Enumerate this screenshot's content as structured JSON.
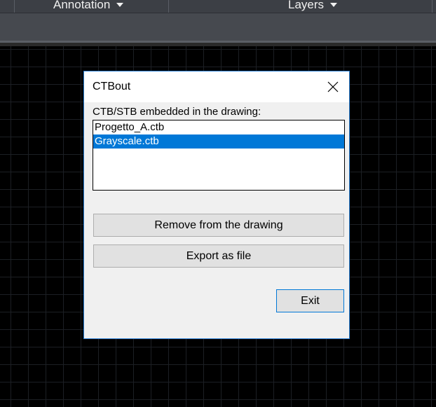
{
  "ribbon": {
    "panels": [
      {
        "label": "Annotation",
        "icon": "caret-down-icon"
      },
      {
        "label": "Layers",
        "icon": "caret-down-icon"
      }
    ]
  },
  "dialog": {
    "title": "CTBout",
    "close_icon": "close-icon",
    "list_label": "CTB/STB embedded in the drawing:",
    "items": [
      {
        "label": "Progetto_A.ctb",
        "selected": false
      },
      {
        "label": "Grayscale.ctb",
        "selected": true
      }
    ],
    "buttons": {
      "remove": "Remove from the drawing",
      "export": "Export as file",
      "exit": "Exit"
    }
  },
  "colors": {
    "selection": "#0078d7",
    "dialog_border": "#2a7fd4",
    "canvas": "#000000"
  }
}
